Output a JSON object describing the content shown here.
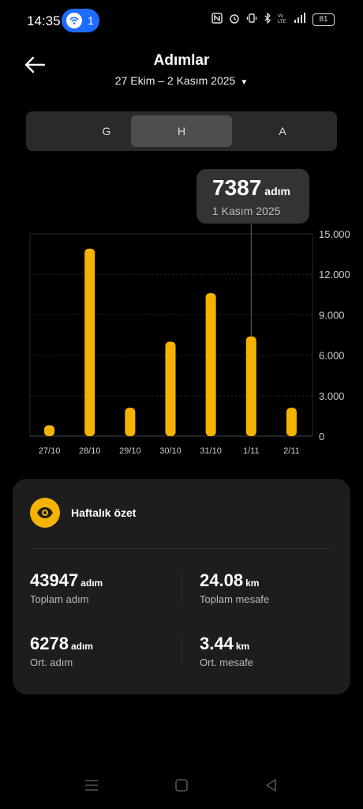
{
  "status_bar": {
    "time": "14:35",
    "hotspot_count": "1",
    "battery": "81",
    "icons": [
      "nfc-icon",
      "alarm-icon",
      "vibrate-icon",
      "bluetooth-icon",
      "volte-icon",
      "signal-icon"
    ]
  },
  "header": {
    "title": "Adımlar",
    "date_range": "27 Ekim – 2 Kasım 2025"
  },
  "tabs": [
    {
      "label": "G",
      "active": false
    },
    {
      "label": "H",
      "active": true
    },
    {
      "label": "A",
      "active": false
    }
  ],
  "tooltip": {
    "value": "7387",
    "unit": "adım",
    "date": "1 Kasım 2025"
  },
  "chart_data": {
    "type": "bar",
    "categories": [
      "27/10",
      "28/10",
      "29/10",
      "30/10",
      "31/10",
      "1/11",
      "2/11"
    ],
    "values": [
      800,
      13900,
      2100,
      7000,
      10600,
      7387,
      2100
    ],
    "ylim": [
      0,
      15000
    ],
    "yticks": [
      "0",
      "3.000",
      "6.000",
      "9.000",
      "12.000",
      "15.000"
    ],
    "selected_index": 5,
    "bar_color": "#f5b301",
    "grid": true
  },
  "summary": {
    "title": "Haftalık özet",
    "total_steps": {
      "value": "43947",
      "unit": "adım",
      "label": "Toplam adım"
    },
    "total_distance": {
      "value": "24.08",
      "unit": "km",
      "label": "Toplam mesafe"
    },
    "avg_steps": {
      "value": "6278",
      "unit": "adım",
      "label": "Ort. adım"
    },
    "avg_distance": {
      "value": "3.44",
      "unit": "km",
      "label": "Ort. mesafe"
    }
  },
  "colors": {
    "accent": "#f5b301",
    "hotspot": "#1e6bff"
  }
}
